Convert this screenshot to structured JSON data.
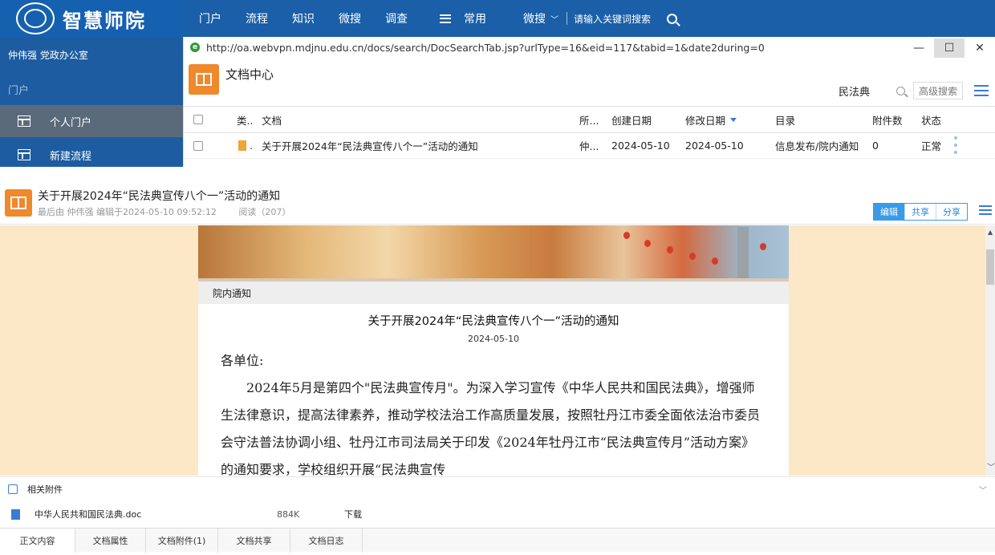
{
  "brand": {
    "name": "智慧师院"
  },
  "nav": {
    "items": [
      "门户",
      "流程",
      "知识",
      "微搜",
      "调查"
    ],
    "menu_label": "常用",
    "search_scope": "微搜",
    "search_placeholder": "请输入关键词搜索"
  },
  "sidebar": {
    "user": "仲伟强  党政办公室",
    "section": "门户",
    "items": [
      {
        "label": "个人门户"
      },
      {
        "label": "新建流程"
      }
    ]
  },
  "browser": {
    "url": "http://oa.webvpn.mdjnu.edu.cn/docs/search/DocSearchTab.jsp?urlType=16&eid=117&tabid=1&date2during=0",
    "min": "—",
    "close": "✕"
  },
  "doc_center": {
    "title": "文档中心",
    "keyword": "民法典",
    "advanced_search": "高级搜索"
  },
  "table": {
    "headers": {
      "type": "类..",
      "doc": "文档",
      "owner": "所...",
      "created": "创建日期",
      "modified": "修改日期",
      "dir": "目录",
      "attach": "附件数",
      "status": "状态"
    },
    "rows": [
      {
        "type": ".",
        "doc": "关于开展2024年“民法典宣传八个一”活动的通知",
        "owner": "仲...",
        "created": "2024-05-10",
        "modified": "2024-05-10",
        "dir": "信息发布/院内通知",
        "attach": "0",
        "status": "正常"
      }
    ]
  },
  "detail": {
    "title": "关于开展2024年“民法典宣传八个一”活动的通知",
    "meta": "最后由 仲伟强 编辑于2024-05-10 09:52:12",
    "reads": "阅读（207）",
    "actions": {
      "edit": "编辑",
      "share": "共享",
      "distribute": "分享"
    }
  },
  "article": {
    "section": "院内通知",
    "title": "关于开展2024年“民法典宣传八个一”活动的通知",
    "date": "2024-05-10",
    "greeting": "各单位:",
    "body": "2024年5月是第四个\"民法典宣传月\"。为深入学习宣传《中华人民共和国民法典》，增强师生法律意识，提高法律素养，推动学校法治工作高质量发展，按照牡丹江市委全面依法治市委员会守法普法协调小组、牡丹江市司法局关于印发《2024年牡丹江市“民法典宣传月”活动方案》的通知要求，学校组织开展“民法典宣传"
  },
  "attachments": {
    "label": "相关附件",
    "files": [
      {
        "name": "中华人民共和国民法典.doc",
        "size": "884K",
        "action": "下载"
      }
    ]
  },
  "tabs": [
    "正文内容",
    "文档属性",
    "文档附件(1)",
    "文档共享",
    "文档日志"
  ],
  "colors": {
    "topbar": "#1a5fa8",
    "accent": "#3a9ae6",
    "doc_icon": "#f0882c",
    "content_bg": "#fce7c6"
  }
}
